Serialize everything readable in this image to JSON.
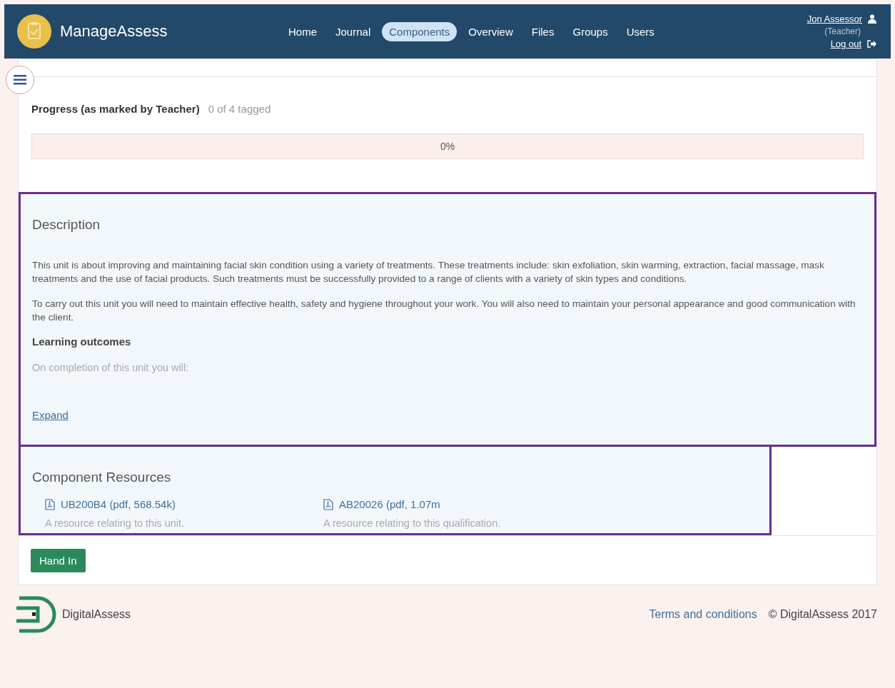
{
  "header": {
    "brand": "ManageAssess",
    "nav": [
      {
        "label": "Home",
        "selected": false
      },
      {
        "label": "Journal",
        "selected": false
      },
      {
        "label": "Components",
        "selected": true
      },
      {
        "label": "Overview",
        "selected": false
      },
      {
        "label": "Files",
        "selected": false
      },
      {
        "label": "Groups",
        "selected": false
      },
      {
        "label": "Users",
        "selected": false
      }
    ],
    "user": {
      "name": "Jon Assessor",
      "role": "(Teacher)",
      "logout": "Log out"
    }
  },
  "progress": {
    "title": "Progress (as marked by Teacher)",
    "count": "0 of 4 tagged",
    "level": 0,
    "reading": "0%"
  },
  "description": {
    "title": "Description",
    "paragraphs": [
      "This unit is about improving and maintaining facial skin condition using a variety of treatments. These treatments include: skin exfoliation, skin warming, extraction, facial massage, mask treatments and the use of facial products. Such treatments must be successfully provided to a range of clients with a variety of skin types and conditions.",
      "To carry out this unit you will need to maintain effective health, safety and hygiene throughout your work. You will also need to maintain your personal appearance and good communication with the client."
    ],
    "subtitle": "Learning outcomes",
    "faded": "On completion of this unit you will:",
    "expand": "Expand"
  },
  "resources": {
    "title": "Component Resources",
    "items": [
      {
        "link": "UB200B4 (pdf, 568.54k)",
        "note": "A resource relating to this unit."
      },
      {
        "link": "AB20026 (pdf, 1.07m",
        "note": "A resource relating to this qualification."
      }
    ]
  },
  "hand_in": "Hand In",
  "footer": {
    "brand": "DigitalAssess",
    "terms": "Terms and conditions",
    "copyright": "© DigitalAssess 2017"
  }
}
